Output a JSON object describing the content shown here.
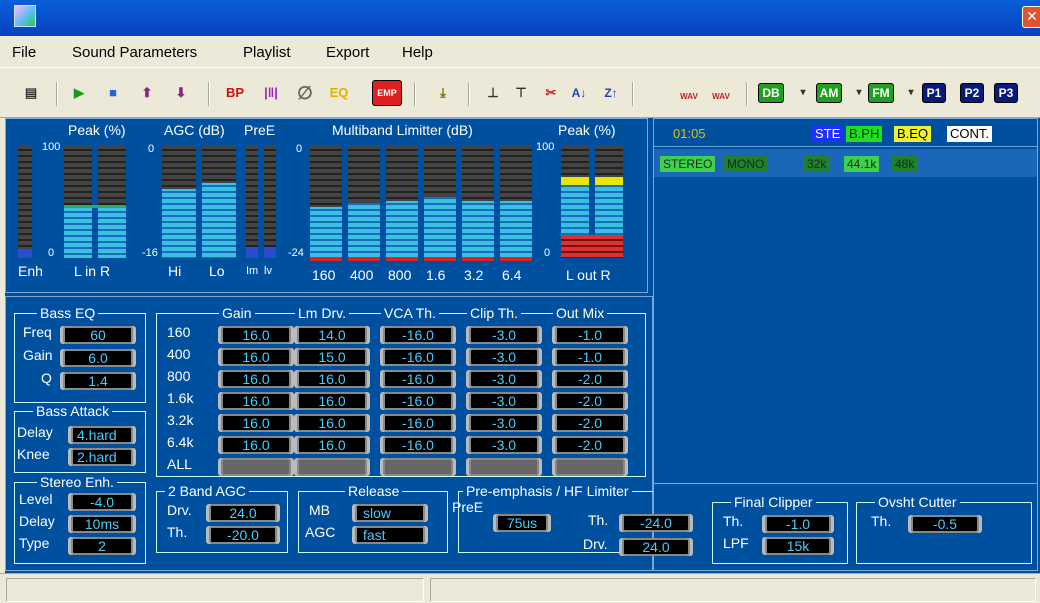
{
  "menu": {
    "items": [
      "File",
      "Sound Parameters",
      "Playlist",
      "Export",
      "Help"
    ]
  },
  "toolbar": {
    "bp_label": "BP",
    "eq_label": "EQ",
    "emp_label": "EMP",
    "wav_label": "WAV",
    "db_label": "DB",
    "am_label": "AM",
    "fm_label": "FM",
    "p1_label": "P1",
    "p2_label": "P2",
    "p3_label": "P3",
    "icons": [
      "playlist-icon",
      "play-icon",
      "stop-icon",
      "up-icon",
      "down-icon",
      "bypass-icon",
      "bars-icon",
      "phase-icon",
      "eq-icon",
      "emp-icon",
      "download-icon",
      "top-icon",
      "bottom-icon",
      "cut-icon",
      "sort-az-icon",
      "sort-za-icon",
      "wav-add-icon",
      "wav-open-icon",
      "db-icon",
      "am-icon",
      "fm-icon",
      "p1-icon",
      "p2-icon",
      "p3-icon"
    ]
  },
  "meters": {
    "peak_title": "Peak (%)",
    "agc_title": "AGC (dB)",
    "pree_title": "PreE",
    "mb_title": "Multiband Limitter (dB)",
    "peak_out_title": "Peak (%)",
    "scale_100": "100",
    "scale_0": "0",
    "scale_m16": "-16",
    "scale_m24": "-24",
    "enh_label": "Enh",
    "lr_in_label": "L in R",
    "hi_label": "Hi",
    "lo_label": "Lo",
    "im_label": "Im",
    "lv_label": "lv",
    "out_label": "L out R",
    "bands": [
      "160",
      "400",
      "800",
      "1.6",
      "3.2",
      "6.4"
    ]
  },
  "status_panel": {
    "time": "01:05",
    "ste": "STE",
    "bph": "B.PH",
    "beq": "B.EQ",
    "cont": "CONT.",
    "stereo": "STEREO",
    "mono": "MONO",
    "r32": "32k",
    "r441": "44.1k",
    "r48": "48k"
  },
  "bass_eq": {
    "title": "Bass EQ",
    "freq_label": "Freq",
    "freq": "60",
    "gain_label": "Gain",
    "gain": "6.0",
    "q_label": "Q",
    "q": "1.4"
  },
  "bass_attack": {
    "title": "Bass Attack",
    "delay_label": "Delay",
    "delay": "4.hard",
    "knee_label": "Knee",
    "knee": "2.hard"
  },
  "stereo_enh": {
    "title": "Stereo Enh.",
    "level_label": "Level",
    "level": "-4.0",
    "delay_label": "Delay",
    "delay": "10ms",
    "type_label": "Type",
    "type": "2"
  },
  "mb_table": {
    "columns": [
      "Gain",
      "Lm Drv.",
      "VCA Th.",
      "Clip Th.",
      "Out Mix"
    ],
    "rows": [
      {
        "band": "160",
        "values": [
          "16.0",
          "14.0",
          "-16.0",
          "-3.0",
          "-1.0"
        ]
      },
      {
        "band": "400",
        "values": [
          "16.0",
          "15.0",
          "-16.0",
          "-3.0",
          "-1.0"
        ]
      },
      {
        "band": "800",
        "values": [
          "16.0",
          "16.0",
          "-16.0",
          "-3.0",
          "-2.0"
        ]
      },
      {
        "band": "1.6k",
        "values": [
          "16.0",
          "16.0",
          "-16.0",
          "-3.0",
          "-2.0"
        ]
      },
      {
        "band": "3.2k",
        "values": [
          "16.0",
          "16.0",
          "-16.0",
          "-3.0",
          "-2.0"
        ]
      },
      {
        "band": "6.4k",
        "values": [
          "16.0",
          "16.0",
          "-16.0",
          "-3.0",
          "-2.0"
        ]
      }
    ],
    "all_label": "ALL"
  },
  "agc2": {
    "title": "2 Band AGC",
    "drv_label": "Drv.",
    "drv": "24.0",
    "th_label": "Th.",
    "th": "-20.0"
  },
  "release": {
    "title": "Release",
    "mb_label": "MB",
    "mb": "slow",
    "agc_label": "AGC",
    "agc": "fast"
  },
  "preemph": {
    "title": "Pre-emphasis / HF Limiter",
    "pree_label": "PreE",
    "pree": "75us",
    "th_label": "Th.",
    "th": "-24.0",
    "drv_label": "Drv.",
    "drv": "24.0"
  },
  "final_clipper": {
    "title": "Final Clipper",
    "th_label": "Th.",
    "th": "-1.0",
    "lpf_label": "LPF",
    "lpf": "15k"
  },
  "ovsht": {
    "title": "Ovsht Cutter",
    "th_label": "Th.",
    "th": "-0.5"
  }
}
